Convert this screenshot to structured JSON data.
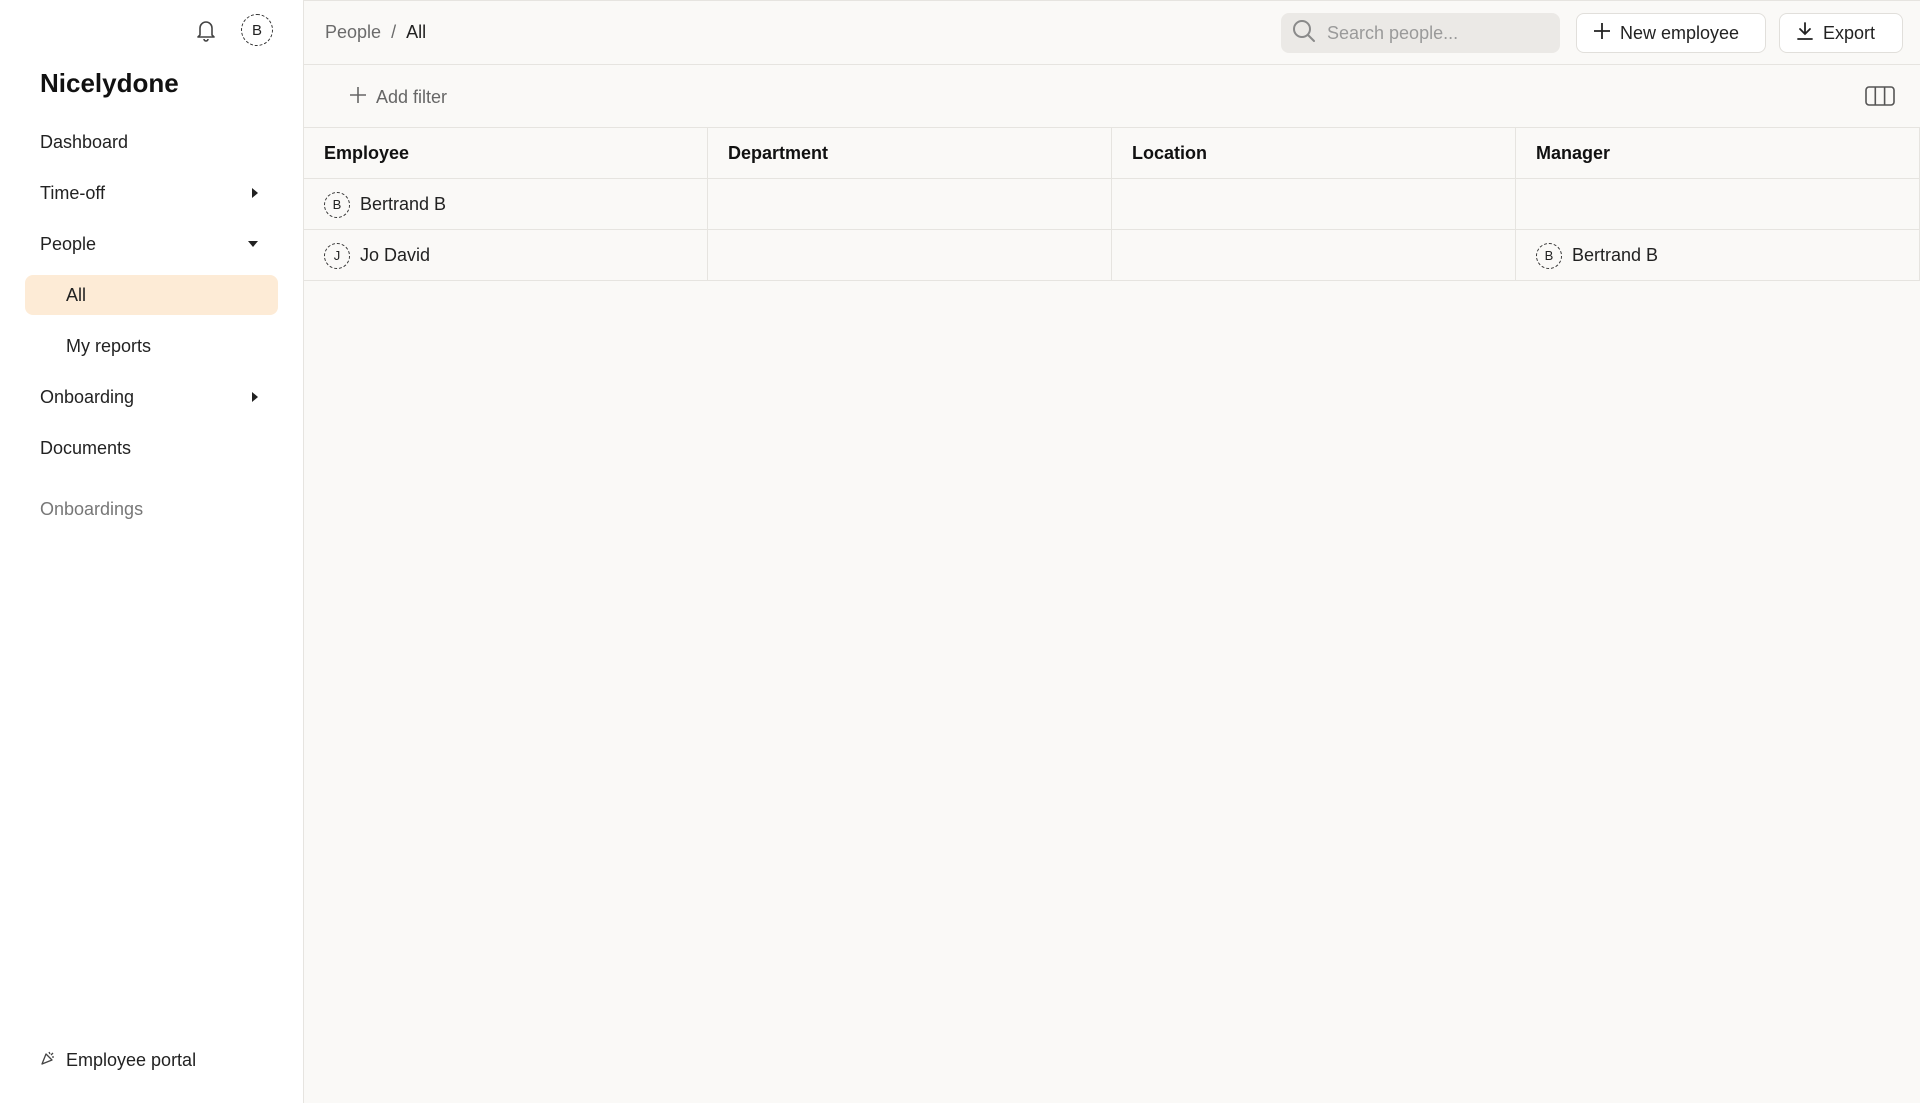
{
  "sidebar": {
    "brand": "Nicelydone",
    "user_initial": "B",
    "nav": [
      {
        "label": "Dashboard"
      },
      {
        "label": "Time-off"
      },
      {
        "label": "People"
      },
      {
        "label": "All"
      },
      {
        "label": "My reports"
      },
      {
        "label": "Onboarding"
      },
      {
        "label": "Documents"
      }
    ],
    "section_label": "Onboardings",
    "portal_label": "Employee portal"
  },
  "header": {
    "breadcrumb": [
      "People",
      "/",
      "All"
    ],
    "search_placeholder": "Search people...",
    "new_employee_label": "New employee",
    "export_label": "Export"
  },
  "filters": {
    "add_filter_label": "Add filter"
  },
  "table": {
    "columns": [
      "Employee",
      "Department",
      "Location",
      "Manager"
    ],
    "rows": [
      {
        "initial": "B",
        "employee": "Bertrand B",
        "department": "",
        "location": "",
        "manager": "",
        "manager_initial": ""
      },
      {
        "initial": "J",
        "employee": "Jo David",
        "department": "",
        "location": "",
        "manager": "Bertrand B",
        "manager_initial": "B"
      }
    ]
  },
  "colors": {
    "active_nav_bg": "#fdebd6",
    "main_bg": "#faf9f7",
    "border": "#e6e4e0"
  }
}
